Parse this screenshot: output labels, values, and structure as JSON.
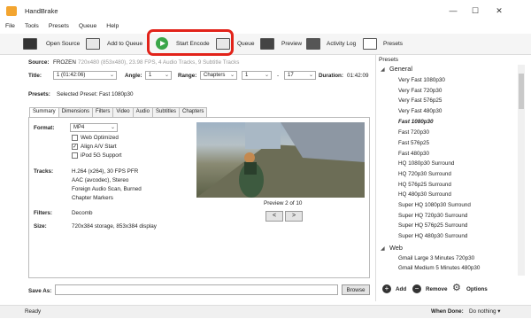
{
  "window": {
    "title": "HandBrake",
    "minimize": "—",
    "maximize": "☐",
    "close": "✕"
  },
  "menu": [
    "File",
    "Tools",
    "Presets",
    "Queue",
    "Help"
  ],
  "toolbar": {
    "open_source": "Open Source",
    "add_to_queue": "Add to Queue",
    "start_encode": "Start Encode",
    "queue": "Queue",
    "preview": "Preview",
    "activity_log": "Activity Log",
    "presets": "Presets"
  },
  "source": {
    "label": "Source:",
    "name": "FROZEN",
    "details": "720x480 (853x480), 23.98 FPS, 4 Audio Tracks, 9 Subtitle Tracks"
  },
  "title_row": {
    "title_label": "Title:",
    "title_value": "1 (01:42:06)",
    "angle_label": "Angle:",
    "angle_value": "1",
    "range_label": "Range:",
    "range_value": "Chapters",
    "range_start": "1",
    "dash": "-",
    "range_end": "17",
    "duration_label": "Duration:",
    "duration_value": "01:42:09"
  },
  "presets_row": {
    "label": "Presets:",
    "selected": "Selected Preset: Fast 1080p30"
  },
  "tabs": [
    "Summary",
    "Dimensions",
    "Filters",
    "Video",
    "Audio",
    "Subtitles",
    "Chapters"
  ],
  "summary": {
    "format_label": "Format:",
    "format_value": "MP4",
    "web_optimized": "Web Optimized",
    "align_av": "Align A/V Start",
    "ipod": "iPod 5G Support",
    "tracks_label": "Tracks:",
    "tracks": [
      "H.264 (x264), 30 FPS PFR",
      "AAC (avcodec), Stereo",
      "Foreign Audio Scan, Burned",
      "Chapter Markers"
    ],
    "filters_label": "Filters:",
    "filters_value": "Decomb",
    "size_label": "Size:",
    "size_value": "720x384 storage, 853x384 display",
    "preview_caption": "Preview 2 of 10",
    "prev": "<",
    "next": ">"
  },
  "save_as": {
    "label": "Save As:",
    "value": "",
    "browse": "Browse"
  },
  "presets_panel": {
    "title": "Presets",
    "groups": [
      {
        "name": "General",
        "items": [
          "Very Fast 1080p30",
          "Very Fast 720p30",
          "Very Fast 576p25",
          "Very Fast 480p30",
          "Fast 1080p30",
          "Fast 720p30",
          "Fast 576p25",
          "Fast 480p30",
          "HQ 1080p30 Surround",
          "HQ 720p30 Surround",
          "HQ 576p25 Surround",
          "HQ 480p30 Surround",
          "Super HQ 1080p30 Surround",
          "Super HQ 720p30 Surround",
          "Super HQ 576p25 Surround",
          "Super HQ 480p30 Surround"
        ]
      },
      {
        "name": "Web",
        "items": [
          "Gmail Large 3 Minutes 720p30",
          "Gmail Medium 5 Minutes 480p30"
        ]
      }
    ],
    "add": "Add",
    "remove": "Remove",
    "options": "Options"
  },
  "status": {
    "text": "Ready",
    "when_done_label": "When Done:",
    "when_done_value": "Do nothing"
  }
}
